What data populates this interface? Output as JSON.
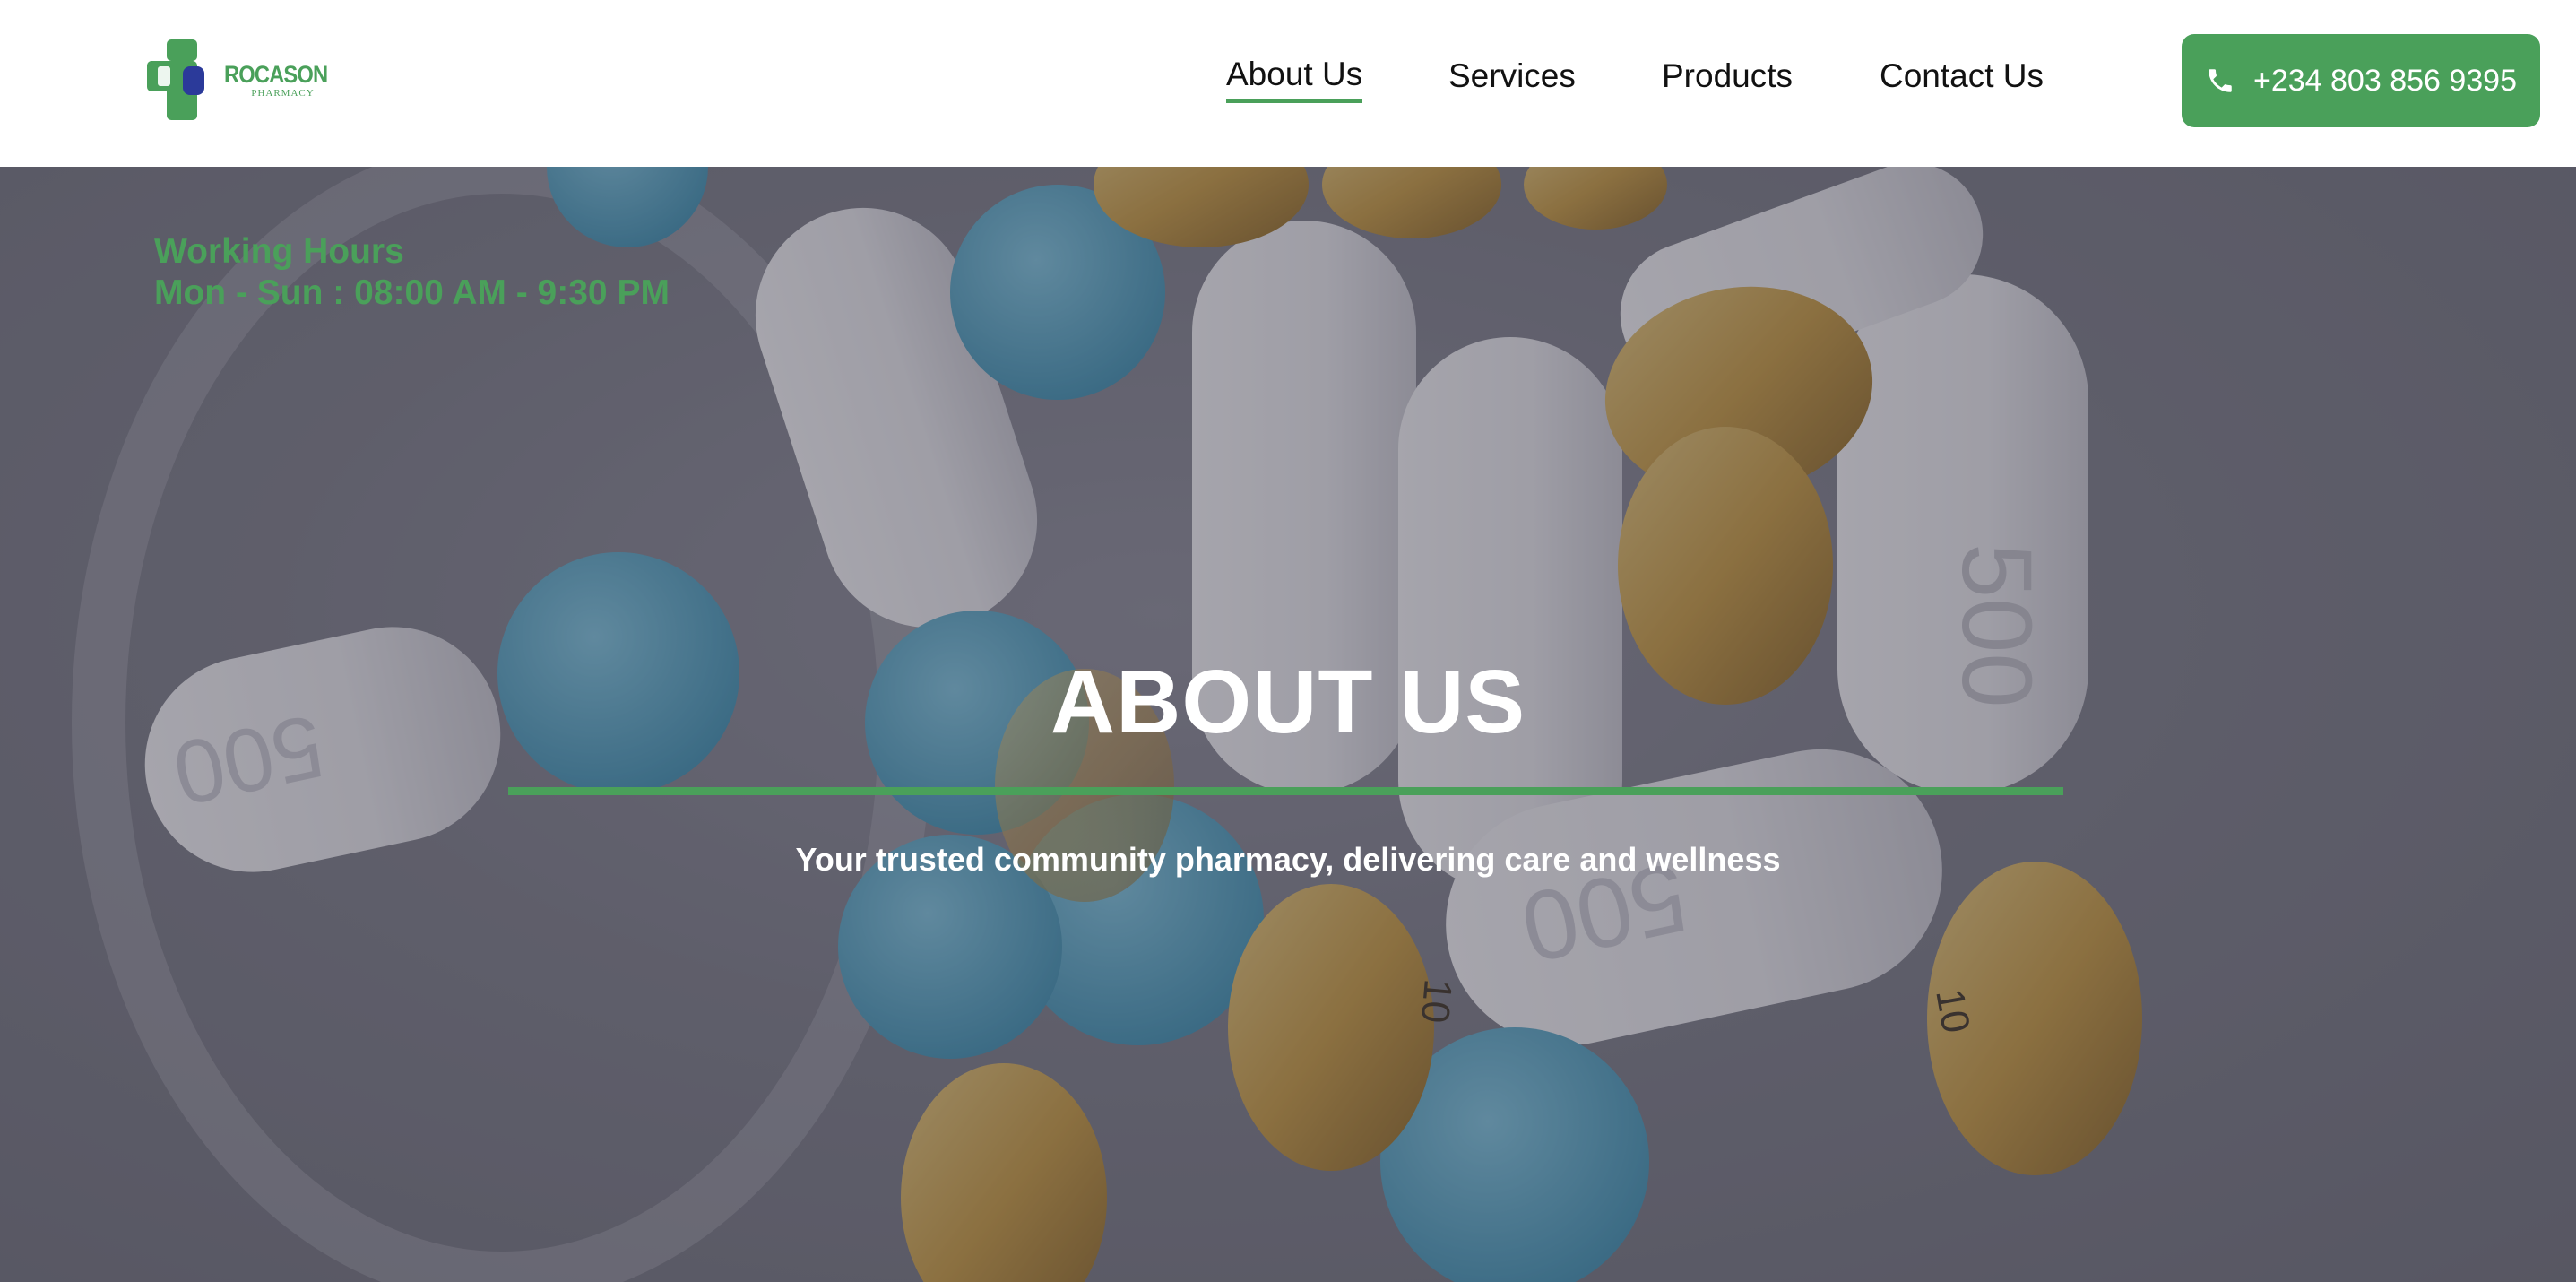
{
  "brand": {
    "name": "ROCASON",
    "subtitle": "PHARMACY",
    "color": "#4aa05a",
    "accent_blue": "#2b3a9a"
  },
  "nav": {
    "items": [
      {
        "label": "About Us",
        "active": true
      },
      {
        "label": "Services",
        "active": false
      },
      {
        "label": "Products",
        "active": false
      },
      {
        "label": "Contact Us",
        "active": false
      }
    ]
  },
  "contact": {
    "phone": "+234 803 856 9395",
    "icon": "phone-icon"
  },
  "hours": {
    "title": "Working Hours",
    "schedule": "Mon - Sun : 08:00 AM - 9:30 PM"
  },
  "hero": {
    "title": "ABOUT US",
    "subtitle": "Your trusted community pharmacy, delivering care and wellness",
    "pill_imprints": [
      "500",
      "500",
      "500",
      "10",
      "10"
    ]
  },
  "colors": {
    "accent": "#4aa05a",
    "text_dark": "#111111",
    "hero_text": "#ffffff"
  }
}
